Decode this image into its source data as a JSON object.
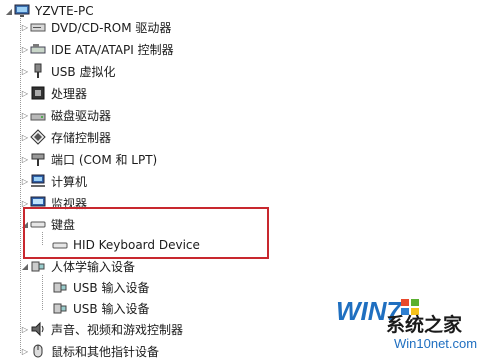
{
  "root": {
    "label": "YZVTE-PC",
    "icon": "computer-monitor-icon"
  },
  "devices": [
    {
      "label": "DVD/CD-ROM 驱动器",
      "icon": "dvd-drive-icon"
    },
    {
      "label": "IDE ATA/ATAPI 控制器",
      "icon": "ide-controller-icon"
    },
    {
      "label": "USB 虚拟化",
      "icon": "usb-plug-icon"
    },
    {
      "label": "处理器",
      "icon": "processor-chip-icon"
    },
    {
      "label": "磁盘驱动器",
      "icon": "disk-drive-icon"
    },
    {
      "label": "存储控制器",
      "icon": "storage-controller-icon"
    },
    {
      "label": "端口 (COM 和 LPT)",
      "icon": "port-icon"
    },
    {
      "label": "计算机",
      "icon": "computer-icon"
    },
    {
      "label": "监视器",
      "icon": "monitor-icon"
    },
    {
      "label": "键盘",
      "icon": "keyboard-icon"
    },
    {
      "label": "HID Keyboard Device",
      "icon": "keyboard-icon"
    },
    {
      "label": "人体学输入设备",
      "icon": "hid-device-icon"
    },
    {
      "label": "USB 输入设备",
      "icon": "hid-device-icon"
    },
    {
      "label": "USB 输入设备",
      "icon": "hid-device-icon"
    },
    {
      "label": "声音、视频和游戏控制器",
      "icon": "speaker-icon"
    },
    {
      "label": "鼠标和其他指针设备",
      "icon": "mouse-icon"
    }
  ],
  "watermark": {
    "brand": "WIN7",
    "site": "系统之家",
    "url": "Win10net.com"
  },
  "colors": {
    "highlight": "#c8282e",
    "brand_blue": "#1f6fc0"
  }
}
